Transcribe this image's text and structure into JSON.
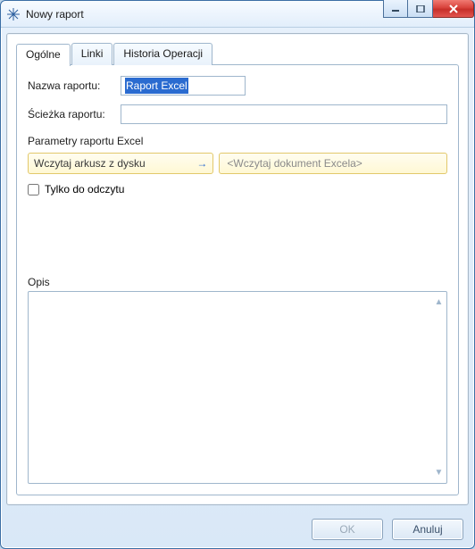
{
  "window": {
    "title": "Nowy raport",
    "controls": {
      "minimize": "minimize",
      "maximize": "maximize",
      "close": "close"
    }
  },
  "tabs": [
    {
      "id": "general",
      "label": "Ogólne",
      "active": true
    },
    {
      "id": "links",
      "label": "Linki",
      "active": false
    },
    {
      "id": "history",
      "label": "Historia Operacji",
      "active": false
    }
  ],
  "form": {
    "name_label": "Nazwa raportu:",
    "name_value": "Raport Excel",
    "path_label": "Ścieżka raportu:",
    "path_value": ""
  },
  "params": {
    "section_label": "Parametry raportu Excel",
    "load_button_label": "Wczytaj arkusz z dysku",
    "load_display_placeholder": "<Wczytaj dokument Excela>",
    "readonly_label": "Tylko do odczytu",
    "readonly_checked": false
  },
  "opis": {
    "label": "Opis",
    "value": ""
  },
  "buttons": {
    "ok": "OK",
    "cancel": "Anuluj"
  },
  "icons": {
    "app": "snowflake-icon",
    "arrow_right": "→"
  }
}
